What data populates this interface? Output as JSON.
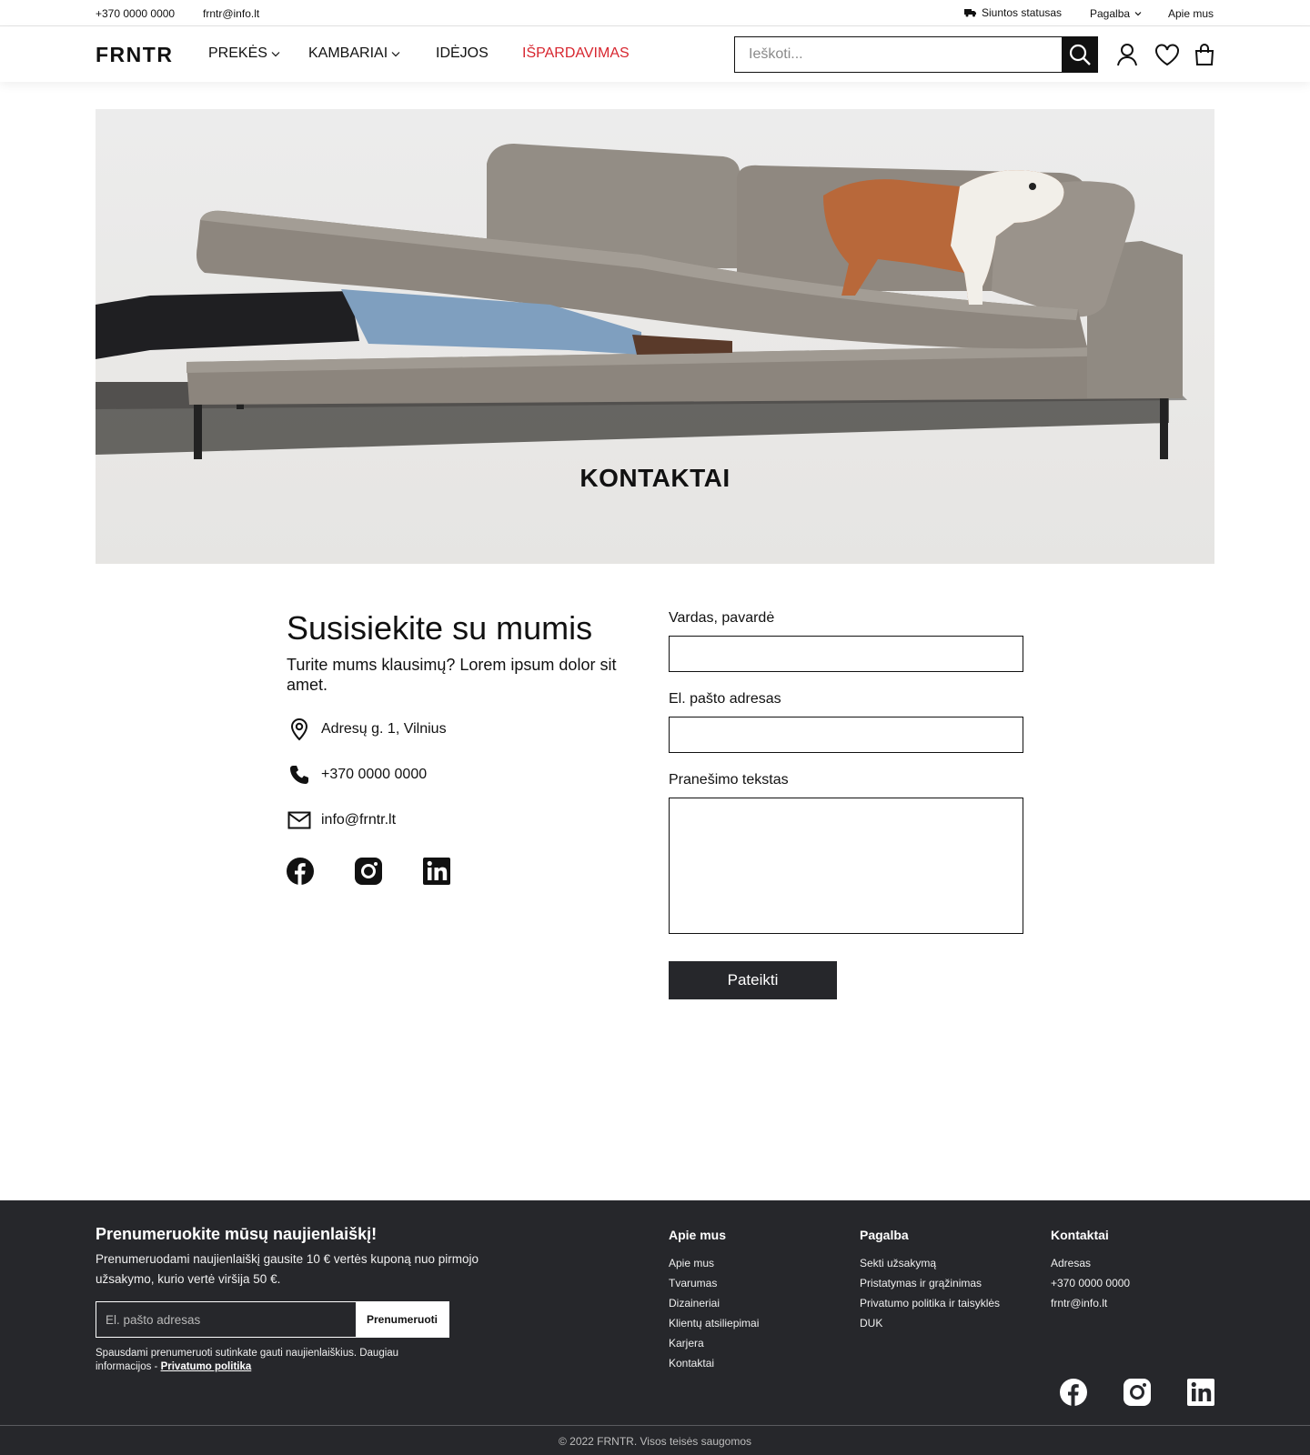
{
  "topbar": {
    "phone": "+370 0000 0000",
    "email": "frntr@info.lt",
    "shipping": "Siuntos statusas",
    "help": "Pagalba",
    "about": "Apie mus"
  },
  "header": {
    "logo": "FRNTR",
    "nav": [
      "PREKĖS",
      "KAMBARIAI",
      "IDĖJOS",
      "IŠPARDAVIMAS"
    ],
    "sale_color": "#d7262f",
    "search_placeholder": "Ieškoti..."
  },
  "hero": {
    "title": "KONTAKTAI"
  },
  "contact": {
    "title": "Susisiekite su mumis",
    "subtitle": "Turite mums klausimų? Lorem ipsum dolor sit amet.",
    "address": "Adresų g. 1, Vilnius",
    "phone": "+370 0000 0000",
    "email": "info@frntr.lt"
  },
  "form": {
    "name_label": "Vardas, pavardė",
    "email_label": "El. pašto adresas",
    "message_label": "Pranešimo tekstas",
    "submit": "Pateikti"
  },
  "footer": {
    "newsletter_title": "Prenumeruokite mūsų naujienlaiškį!",
    "newsletter_text": "Prenumeruodami naujienlaiškį gausite 10 € vertės kuponą nuo pirmojo užsakymo, kurio vertė viršija 50 €.",
    "newsletter_placeholder": "El. pašto adresas",
    "newsletter_button": "Prenumeruoti",
    "newsletter_note": "Spausdami prenumeruoti sutinkate gauti naujienlaiškius. Daugiau informacijos - ",
    "privacy_link": "Privatumo politika",
    "columns": [
      {
        "title": "Apie mus",
        "links": [
          "Apie mus",
          "Tvarumas",
          "Dizaineriai",
          "Klientų atsiliepimai",
          "Karjera",
          "Kontaktai"
        ]
      },
      {
        "title": "Pagalba",
        "links": [
          "Sekti užsakymą",
          "Pristatymas ir grąžinimas",
          "Privatumo politika ir taisyklės",
          "DUK"
        ]
      },
      {
        "title": "Kontaktai",
        "links": [
          "Adresas",
          "+370 0000 0000",
          "frntr@info.lt"
        ]
      }
    ],
    "copyright": "© 2022 FRNTR. Visos teisės saugomos",
    "background": "#26272b"
  }
}
